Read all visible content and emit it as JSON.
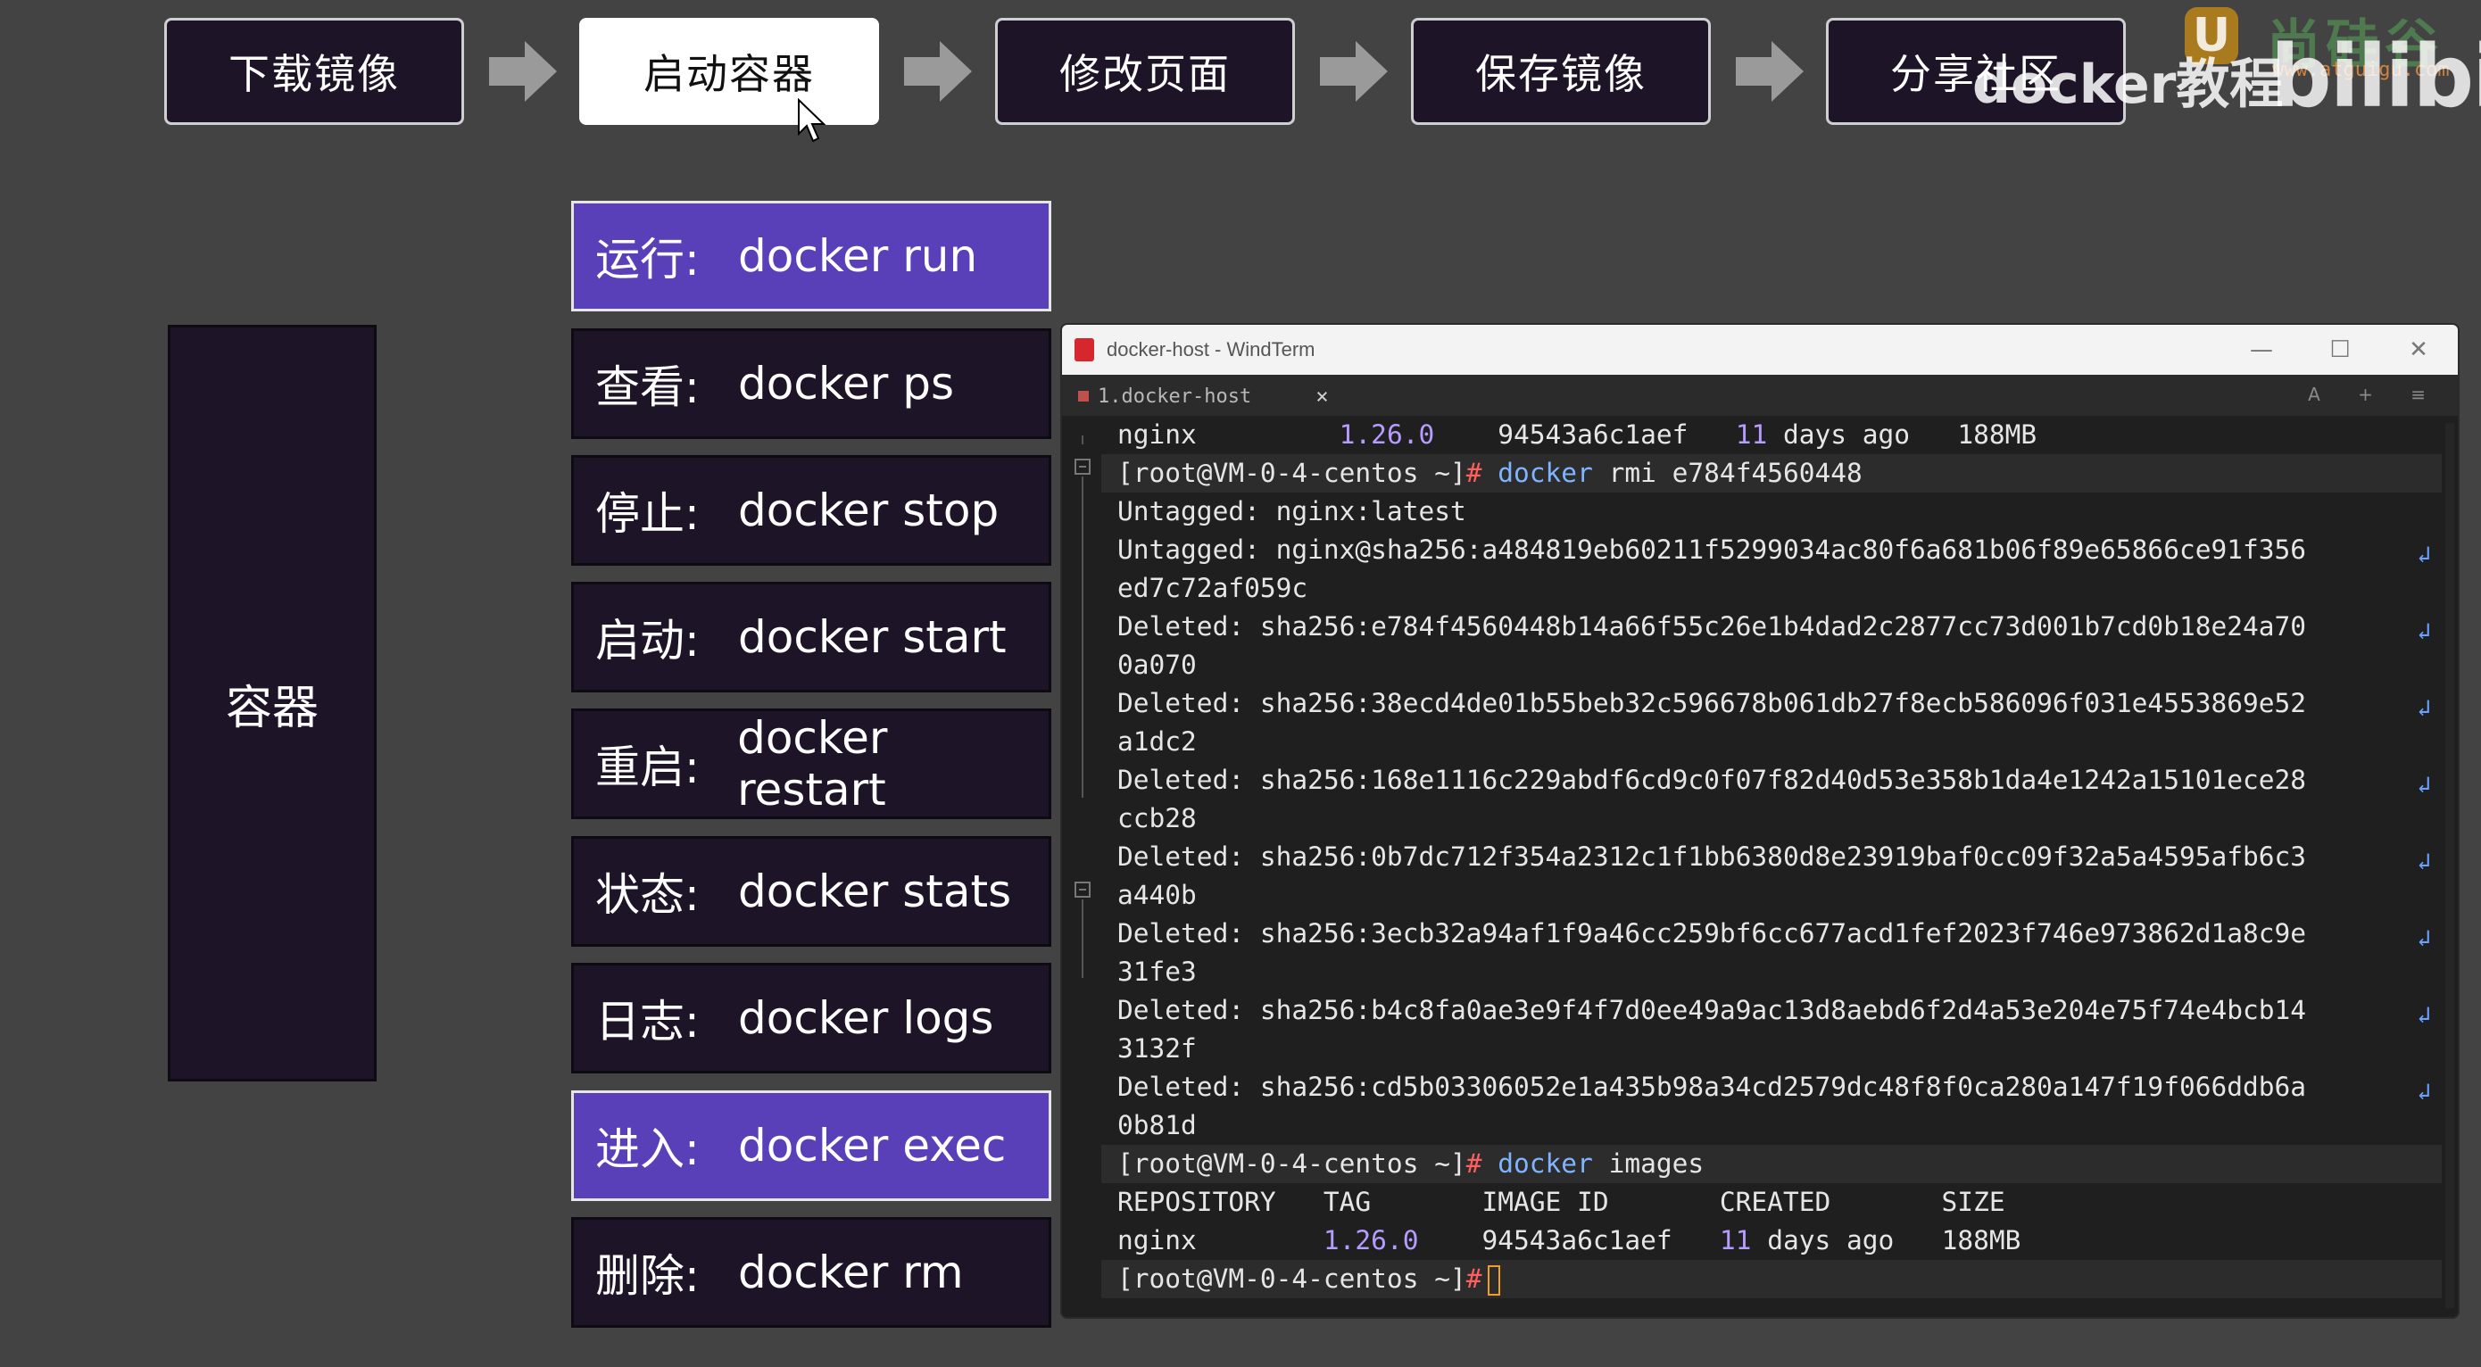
{
  "flow_steps": [
    {
      "label": "下载镜像",
      "active": false
    },
    {
      "label": "启动容器",
      "active": true
    },
    {
      "label": "修改页面",
      "active": false
    },
    {
      "label": "保存镜像",
      "active": false
    },
    {
      "label": "分享社区",
      "active": false
    }
  ],
  "watermark": {
    "logo_letter": "U",
    "brand": "尚硅谷",
    "url": "www.atguigu.com",
    "course": "docker教程",
    "bili": "bilibili"
  },
  "container_label": "容器",
  "commands": [
    {
      "label": "运行:",
      "code": "docker run",
      "highlighted": true
    },
    {
      "label": "查看:",
      "code": "docker ps",
      "highlighted": false
    },
    {
      "label": "停止:",
      "code": "docker stop",
      "highlighted": false
    },
    {
      "label": "启动:",
      "code": "docker start",
      "highlighted": false
    },
    {
      "label": "重启:",
      "code": "docker restart",
      "highlighted": false
    },
    {
      "label": "状态:",
      "code": "docker stats",
      "highlighted": false
    },
    {
      "label": "日志:",
      "code": "docker logs",
      "highlighted": false
    },
    {
      "label": "进入:",
      "code": "docker exec",
      "highlighted": true
    },
    {
      "label": "删除:",
      "code": "docker rm",
      "highlighted": false
    }
  ],
  "terminal": {
    "window_title": "docker-host - WindTerm",
    "tab_label": "1.docker-host",
    "tab_close": "×",
    "tools": "A + ≡",
    "controls": {
      "minimize": "—",
      "maximize": "☐",
      "close": "✕"
    },
    "prompt": "[root@VM-0-4-centos ~]",
    "prompt_hash": "#",
    "lines": [
      {
        "type": "text",
        "parts": [
          [
            "",
            "nginx         "
          ],
          [
            "num",
            "1.26.0"
          ],
          [
            "",
            "    94543a6c1aef   "
          ],
          [
            "num",
            "11"
          ],
          [
            "",
            " days ago   188MB"
          ]
        ]
      },
      {
        "type": "prompt",
        "cmd": "docker",
        "args": " rmi e784f4560448"
      },
      {
        "type": "text",
        "parts": [
          [
            "",
            "Untagged: nginx:latest"
          ]
        ]
      },
      {
        "type": "text",
        "parts": [
          [
            "",
            "Untagged: nginx@sha256:a484819eb60211f5299034ac80f6a681b06f89e65866ce91f356"
          ]
        ],
        "wrap": true
      },
      {
        "type": "text",
        "parts": [
          [
            "",
            "ed7c72af059c"
          ]
        ]
      },
      {
        "type": "text",
        "parts": [
          [
            "",
            "Deleted: sha256:e784f4560448b14a66f55c26e1b4dad2c2877cc73d001b7cd0b18e24a70"
          ]
        ],
        "wrap": true
      },
      {
        "type": "text",
        "parts": [
          [
            "",
            "0a070"
          ]
        ]
      },
      {
        "type": "text",
        "parts": [
          [
            "",
            "Deleted: sha256:38ecd4de01b55beb32c596678b061db27f8ecb586096f031e4553869e52"
          ]
        ],
        "wrap": true
      },
      {
        "type": "text",
        "parts": [
          [
            "",
            "a1dc2"
          ]
        ]
      },
      {
        "type": "text",
        "parts": [
          [
            "",
            "Deleted: sha256:168e1116c229abdf6cd9c0f07f82d40d53e358b1da4e1242a15101ece28"
          ]
        ],
        "wrap": true
      },
      {
        "type": "text",
        "parts": [
          [
            "",
            "ccb28"
          ]
        ]
      },
      {
        "type": "text",
        "parts": [
          [
            "",
            "Deleted: sha256:0b7dc712f354a2312c1f1bb6380d8e23919baf0cc09f32a5a4595afb6c3"
          ]
        ],
        "wrap": true
      },
      {
        "type": "text",
        "parts": [
          [
            "",
            "a440b"
          ]
        ]
      },
      {
        "type": "text",
        "parts": [
          [
            "",
            "Deleted: sha256:3ecb32a94af1f9a46cc259bf6cc677acd1fef2023f746e973862d1a8c9e"
          ]
        ],
        "wrap": true
      },
      {
        "type": "text",
        "parts": [
          [
            "",
            "31fe3"
          ]
        ]
      },
      {
        "type": "text",
        "parts": [
          [
            "",
            "Deleted: sha256:b4c8fa0ae3e9f4f7d0ee49a9ac13d8aebd6f2d4a53e204e75f74e4bcb14"
          ]
        ],
        "wrap": true
      },
      {
        "type": "text",
        "parts": [
          [
            "",
            "3132f"
          ]
        ]
      },
      {
        "type": "text",
        "parts": [
          [
            "",
            "Deleted: sha256:cd5b03306052e1a435b98a34cd2579dc48f8f0ca280a147f19f066ddb6a"
          ]
        ],
        "wrap": true
      },
      {
        "type": "text",
        "parts": [
          [
            "",
            "0b81d"
          ]
        ]
      },
      {
        "type": "prompt",
        "cmd": "docker",
        "args": " images"
      },
      {
        "type": "text",
        "parts": [
          [
            "",
            "REPOSITORY   TAG       IMAGE ID       CREATED       SIZE"
          ]
        ]
      },
      {
        "type": "text",
        "parts": [
          [
            "",
            "nginx        "
          ],
          [
            "num",
            "1.26.0"
          ],
          [
            "",
            "    94543a6c1aef   "
          ],
          [
            "num",
            "11"
          ],
          [
            "",
            " days ago   188MB"
          ]
        ]
      },
      {
        "type": "cursor"
      }
    ]
  }
}
